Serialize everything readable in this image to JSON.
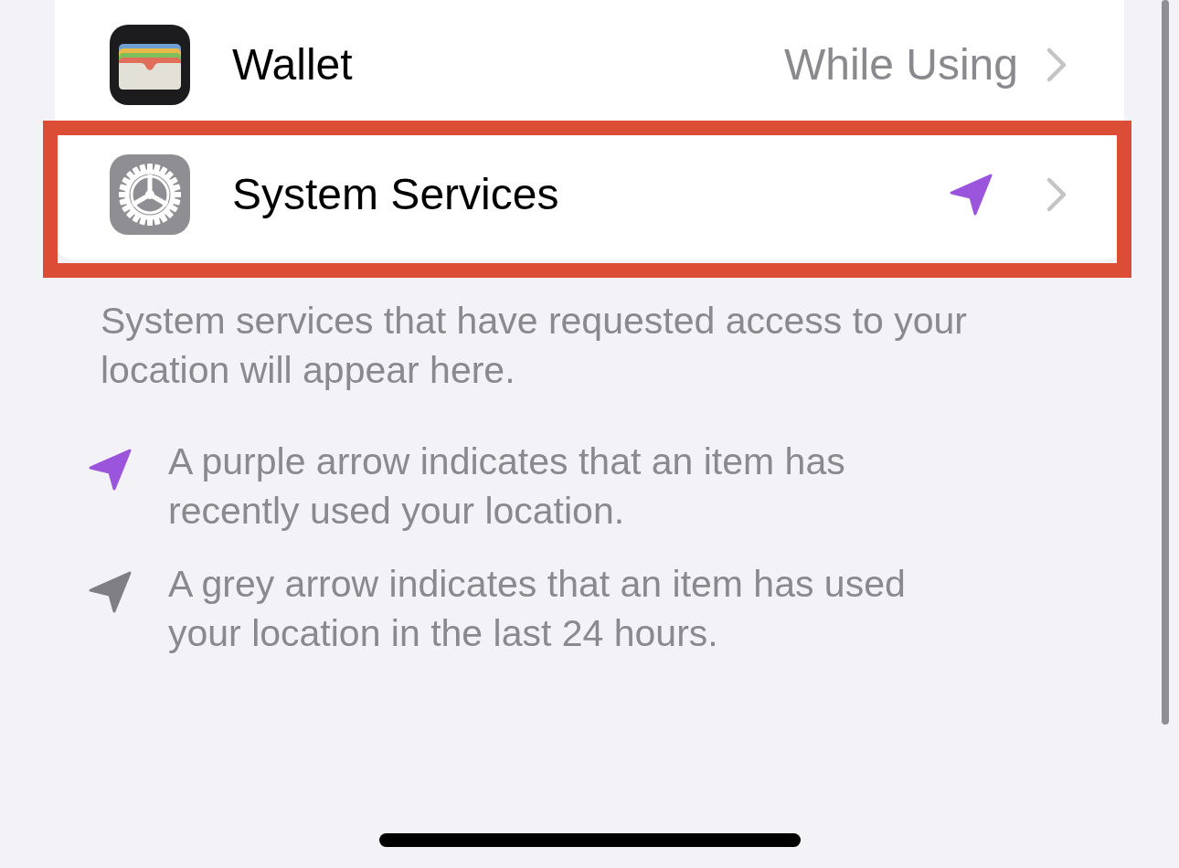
{
  "rows": [
    {
      "kind": "wallet",
      "title": "Wallet",
      "accessory": {
        "kind": "text",
        "text": "While Using"
      },
      "highlighted": false
    },
    {
      "kind": "gear",
      "title": "System Services",
      "accessory": {
        "kind": "arrow",
        "color": "#9a55dc"
      },
      "highlighted": true
    }
  ],
  "footer": "System services that have requested access to your location will appear here.",
  "legend": [
    {
      "color": "#9a55dc",
      "text": "A purple arrow indicates that an item has recently used your location."
    },
    {
      "color": "#7f7f84",
      "text": "A grey arrow indicates that an item has used your location in the last 24 hours."
    }
  ]
}
